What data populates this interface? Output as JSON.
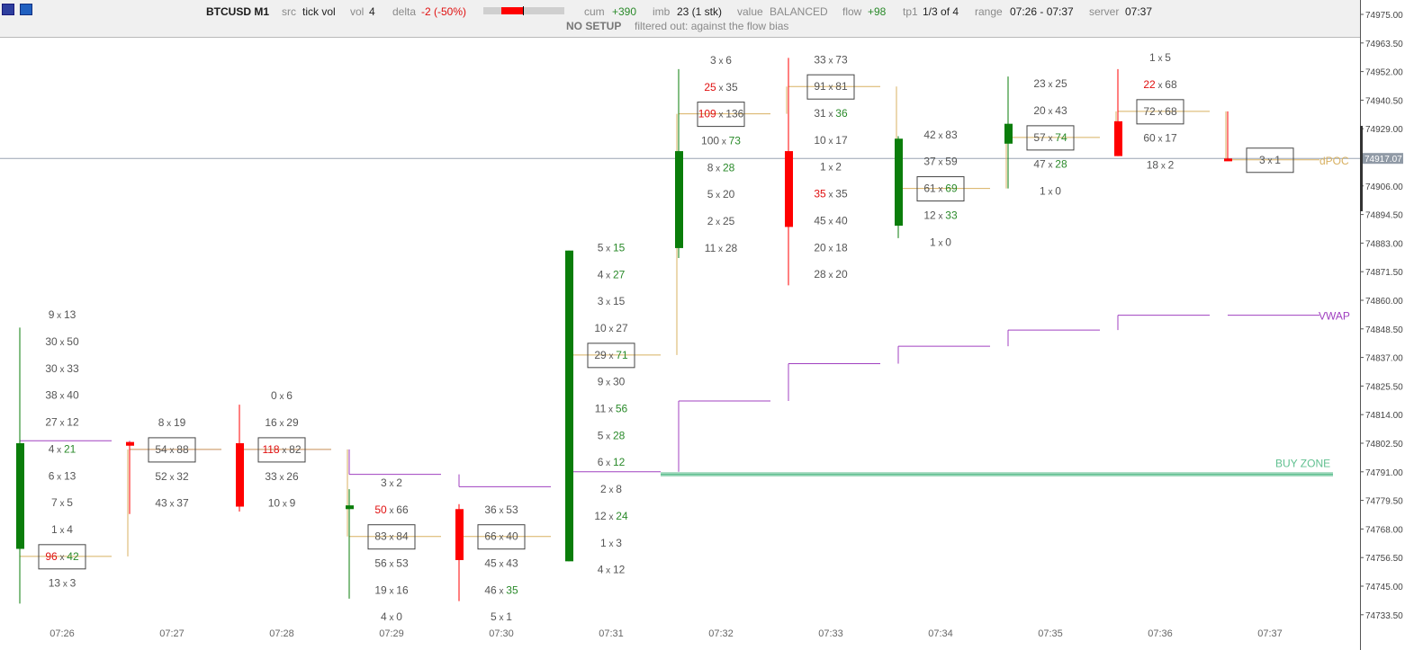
{
  "header": {
    "symbol": "BTCUSD M1",
    "src_label": "src",
    "src_value": "tick vol",
    "vol_label": "vol",
    "vol_value": "4",
    "delta_label": "delta",
    "delta_value": "-2 (-50%)",
    "delta_bar_fill": 0.27,
    "cum_label": "cum",
    "cum_value": "+390",
    "imb_label": "imb",
    "imb_value": "23 (1 stk)",
    "value_label": "value",
    "value_value": "BALANCED",
    "flow_label": "flow",
    "flow_value": "+98",
    "tp1_label": "tp1",
    "tp1_value": "1/3 of 4",
    "range_label": "range",
    "range_value": "07:26 - 07:37",
    "server_label": "server",
    "server_value": "07:37",
    "setup_status": "NO SETUP",
    "setup_note": "filtered out: against the flow bias"
  },
  "colors": {
    "bull": "#0a7d0a",
    "bear": "#ff0000",
    "poc": "#d8b060",
    "vwap": "#a040c0",
    "buy_zone": "#60c090",
    "text": "#555555",
    "bid_strong": "#e01010",
    "ask_strong": "#2a8a2a",
    "crosshair": "#98a4b2"
  },
  "price_axis": {
    "labels": [
      "74975.00",
      "74963.50",
      "74952.00",
      "74940.50",
      "74929.00",
      "74917.50",
      "74906.00",
      "74894.50",
      "74883.00",
      "74871.50",
      "74860.00",
      "74848.50",
      "74837.00",
      "74825.50",
      "74814.00",
      "74802.50",
      "74791.00",
      "74779.50",
      "74768.00",
      "74756.50",
      "74745.00",
      "74733.50"
    ],
    "current_price": "74917.07"
  },
  "time_axis": [
    "07:26",
    "07:27",
    "07:28",
    "07:29",
    "07:30",
    "07:31",
    "07:32",
    "07:33",
    "07:34",
    "07:35",
    "07:36",
    "07:37"
  ],
  "chart_labels": {
    "vwap": "VWAP",
    "buy_zone": "BUY ZONE",
    "dpoc": "dPOC"
  },
  "candles": [
    {
      "time": "07:26",
      "open": 74760.0,
      "close": 74802.5,
      "high": 74849.0,
      "low": 74738.0,
      "poc": 74757.0,
      "vwap": 74803.5,
      "levels": [
        [
          "9",
          "13"
        ],
        [
          "30",
          "50"
        ],
        [
          "30",
          "33"
        ],
        [
          "38",
          "40"
        ],
        [
          "27",
          "12"
        ],
        [
          "4",
          "21"
        ],
        [
          "6",
          "13"
        ],
        [
          "7",
          "5"
        ],
        [
          "1",
          "4"
        ],
        [
          "96",
          "42"
        ],
        [
          "13",
          "3"
        ]
      ],
      "poc_row": 9,
      "bid_hi": [
        9
      ],
      "ask_hi": [
        5,
        9
      ]
    },
    {
      "time": "07:27",
      "open": 74803.0,
      "close": 74801.5,
      "high": 74803.0,
      "low": 74774.0,
      "poc": 74800.0,
      "vwap": 74800.0,
      "levels": [
        [
          "8",
          "19"
        ],
        [
          "54",
          "88"
        ],
        [
          "52",
          "32"
        ],
        [
          "43",
          "37"
        ]
      ],
      "poc_row": 1,
      "bid_hi": [],
      "ask_hi": []
    },
    {
      "time": "07:28",
      "open": 74802.5,
      "close": 74777.0,
      "high": 74818.0,
      "low": 74775.0,
      "poc": 74800.0,
      "vwap": 74800.0,
      "levels": [
        [
          "0",
          "6"
        ],
        [
          "16",
          "29"
        ],
        [
          "118",
          "82"
        ],
        [
          "33",
          "26"
        ],
        [
          "10",
          "9"
        ]
      ],
      "poc_row": 2,
      "bid_hi": [
        2
      ],
      "ask_hi": []
    },
    {
      "time": "07:29",
      "open": 74776.0,
      "close": 74777.5,
      "high": 74784.0,
      "low": 74740.0,
      "poc": 74765.0,
      "vwap": 74790.0,
      "levels": [
        [
          "3",
          "2"
        ],
        [
          "50",
          "66"
        ],
        [
          "83",
          "84"
        ],
        [
          "56",
          "53"
        ],
        [
          "19",
          "16"
        ],
        [
          "4",
          "0"
        ]
      ],
      "poc_row": 2,
      "bid_hi": [
        1
      ],
      "ask_hi": []
    },
    {
      "time": "07:30",
      "open": 74776.0,
      "close": 74755.5,
      "high": 74778.0,
      "low": 74739.0,
      "poc": 74765.0,
      "vwap": 74785.0,
      "levels": [
        [
          "36",
          "53"
        ],
        [
          "66",
          "40"
        ],
        [
          "45",
          "43"
        ],
        [
          "46",
          "35"
        ],
        [
          "5",
          "1"
        ]
      ],
      "poc_row": 1,
      "bid_hi": [],
      "ask_hi": [
        3
      ]
    },
    {
      "time": "07:31",
      "open": 74755.0,
      "close": 74880.0,
      "high": 74880.0,
      "low": 74755.0,
      "poc": 74838.0,
      "vwap": 74791.0,
      "levels": [
        [
          "5",
          "15"
        ],
        [
          "4",
          "27"
        ],
        [
          "3",
          "15"
        ],
        [
          "10",
          "27"
        ],
        [
          "29",
          "71"
        ],
        [
          "9",
          "30"
        ],
        [
          "11",
          "56"
        ],
        [
          "5",
          "28"
        ],
        [
          "6",
          "12"
        ],
        [
          "2",
          "8"
        ],
        [
          "12",
          "24"
        ],
        [
          "1",
          "3"
        ],
        [
          "4",
          "12"
        ]
      ],
      "poc_row": 4,
      "bid_hi": [],
      "ask_hi": [
        0,
        1,
        4,
        6,
        7,
        8,
        10
      ]
    },
    {
      "time": "07:32",
      "open": 74881.0,
      "close": 74920.0,
      "high": 74953.0,
      "low": 74877.0,
      "poc": 74935.0,
      "vwap": 74819.5,
      "levels": [
        [
          "3",
          "6"
        ],
        [
          "25",
          "35"
        ],
        [
          "109",
          "136"
        ],
        [
          "100",
          "73"
        ],
        [
          "8",
          "28"
        ],
        [
          "5",
          "20"
        ],
        [
          "2",
          "25"
        ],
        [
          "11",
          "28"
        ]
      ],
      "poc_row": 2,
      "bid_hi": [
        1,
        2
      ],
      "ask_hi": [
        3,
        4
      ]
    },
    {
      "time": "07:33",
      "open": 74920.0,
      "close": 74889.5,
      "high": 74957.5,
      "low": 74866.0,
      "poc": 74946.0,
      "vwap": 74834.5,
      "levels": [
        [
          "33",
          "73"
        ],
        [
          "91",
          "81"
        ],
        [
          "31",
          "36"
        ],
        [
          "10",
          "17"
        ],
        [
          "1",
          "2"
        ],
        [
          "35",
          "35"
        ],
        [
          "45",
          "40"
        ],
        [
          "20",
          "18"
        ],
        [
          "28",
          "20"
        ]
      ],
      "poc_row": 1,
      "bid_hi": [
        5
      ],
      "ask_hi": [
        2
      ]
    },
    {
      "time": "07:34",
      "open": 74890.0,
      "close": 74925.0,
      "high": 74926.0,
      "low": 74885.0,
      "poc": 74905.0,
      "vwap": 74841.5,
      "levels": [
        [
          "42",
          "83"
        ],
        [
          "37",
          "59"
        ],
        [
          "61",
          "69"
        ],
        [
          "12",
          "33"
        ],
        [
          "1",
          "0"
        ]
      ],
      "poc_row": 2,
      "bid_hi": [],
      "ask_hi": [
        2,
        3
      ]
    },
    {
      "time": "07:35",
      "open": 74923.0,
      "close": 74931.0,
      "high": 74950.0,
      "low": 74905.0,
      "poc": 74925.5,
      "vwap": 74848.0,
      "levels": [
        [
          "23",
          "25"
        ],
        [
          "20",
          "43"
        ],
        [
          "57",
          "74"
        ],
        [
          "47",
          "28"
        ],
        [
          "1",
          "0"
        ]
      ],
      "poc_row": 2,
      "bid_hi": [],
      "ask_hi": [
        2,
        3
      ]
    },
    {
      "time": "07:36",
      "open": 74932.0,
      "close": 74918.0,
      "high": 74953.0,
      "low": 74918.0,
      "poc": 74936.0,
      "vwap": 74854.0,
      "levels": [
        [
          "1",
          "5"
        ],
        [
          "22",
          "68"
        ],
        [
          "72",
          "68"
        ],
        [
          "60",
          "17"
        ],
        [
          "18",
          "2"
        ]
      ],
      "poc_row": 2,
      "bid_hi": [
        1
      ],
      "ask_hi": []
    },
    {
      "time": "07:37",
      "open": 74917.0,
      "close": 74916.0,
      "high": 74936.0,
      "low": 74916.0,
      "poc": 74916.5,
      "vwap": 74854.0,
      "levels": [
        [
          "3",
          "1"
        ]
      ],
      "poc_row": 0,
      "bid_hi": [],
      "ask_hi": []
    }
  ]
}
